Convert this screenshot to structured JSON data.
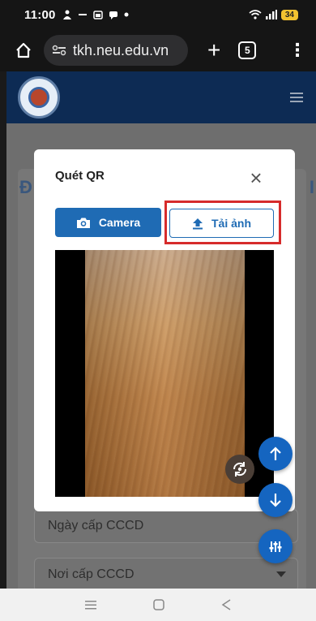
{
  "status_bar": {
    "time": "11:00",
    "battery": "34"
  },
  "browser": {
    "url": "tkh.neu.edu.vn",
    "tab_count": "5"
  },
  "page": {
    "heading_left": "Đ",
    "heading_right": "I",
    "fields": [
      {
        "placeholder": "Ngày cấp CCCD"
      },
      {
        "placeholder": "Nơi cấp CCCD"
      }
    ]
  },
  "modal": {
    "title": "Quét QR",
    "close_symbol": "×",
    "camera_label": "Camera",
    "upload_label": "Tải ảnh"
  },
  "colors": {
    "primary": "#1f6bb4",
    "highlight": "#d62b2b",
    "header": "#0d2b54"
  }
}
